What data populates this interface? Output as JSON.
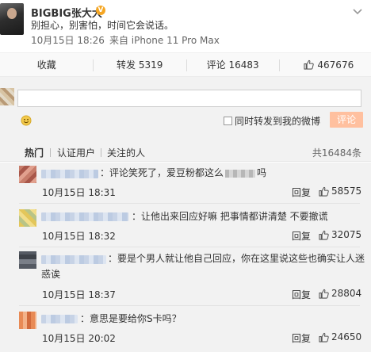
{
  "post": {
    "username": "BIGBIG张大大",
    "text": "别担心，别害怕，时间它会说话。",
    "date": "10月15日 18:26",
    "source": "来自 iPhone 11 Pro Max"
  },
  "actions": {
    "favorite": "收藏",
    "repost": "转发 5319",
    "comment": "评论 16483",
    "like": "467676"
  },
  "composer": {
    "input_value": "",
    "also_forward": "同时转发到我的微博",
    "submit": "评论"
  },
  "tabs": {
    "hot": "热门",
    "verified": "认证用户",
    "following": "关注的人",
    "total": "共16484条"
  },
  "comments": [
    {
      "text_before": "：评论笑死了，爱豆粉都这么",
      "text_after": "吗",
      "time": "10月15日 18:31",
      "reply": "回复",
      "likes": "58575",
      "avatar_color": "#c77c6a"
    },
    {
      "text": "：让他出来回应好嘛 把事情都讲清楚 不要撤谎",
      "time": "10月15日 18:32",
      "reply": "回复",
      "likes": "32075",
      "avatar_color": "#e3c65a"
    },
    {
      "text_line1": "：要是个男人就让他自己回应，你在这里说这些也确实让人迷",
      "text_line2": "惑诶",
      "time": "10月15日 18:37",
      "reply": "回复",
      "likes": "28804",
      "avatar_color": "#555a63"
    },
    {
      "text": "：意思是要给你S卡吗？",
      "time": "10月15日 20:02",
      "reply": "回复",
      "likes": "24650",
      "avatar_color": "#e88a55"
    }
  ]
}
